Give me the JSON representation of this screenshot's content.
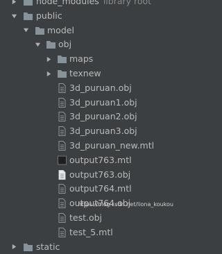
{
  "tree": {
    "node_modules": {
      "label": "node_modules",
      "note": "library root"
    },
    "public": {
      "label": "public"
    },
    "model": {
      "label": "model"
    },
    "obj": {
      "label": "obj"
    },
    "maps": {
      "label": "maps"
    },
    "texnew": {
      "label": "texnew"
    },
    "files": [
      {
        "label": "3d_puruan.obj",
        "type": "obj"
      },
      {
        "label": "3d_puruan1.obj",
        "type": "obj"
      },
      {
        "label": "3d_puruan2.obj",
        "type": "obj"
      },
      {
        "label": "3d_puruan3.obj",
        "type": "obj"
      },
      {
        "label": "3d_puruan_new.mtl",
        "type": "mtl"
      },
      {
        "label": "output763.mtl",
        "type": "mtl-dark"
      },
      {
        "label": "output763.obj",
        "type": "obj-white"
      },
      {
        "label": "output764.mtl",
        "type": "mtl"
      },
      {
        "label": "output764.obj",
        "type": "obj"
      },
      {
        "label": "test.obj",
        "type": "obj"
      },
      {
        "label": "test_5.mtl",
        "type": "mtl"
      }
    ],
    "static": {
      "label": "static"
    }
  },
  "watermark": "https://blog.csdn.net/liona_koukou",
  "colors": {
    "background": "#3c3f41",
    "text": "#bbbbbb",
    "folder": "#87939a",
    "file_icon": "#8c959c"
  }
}
